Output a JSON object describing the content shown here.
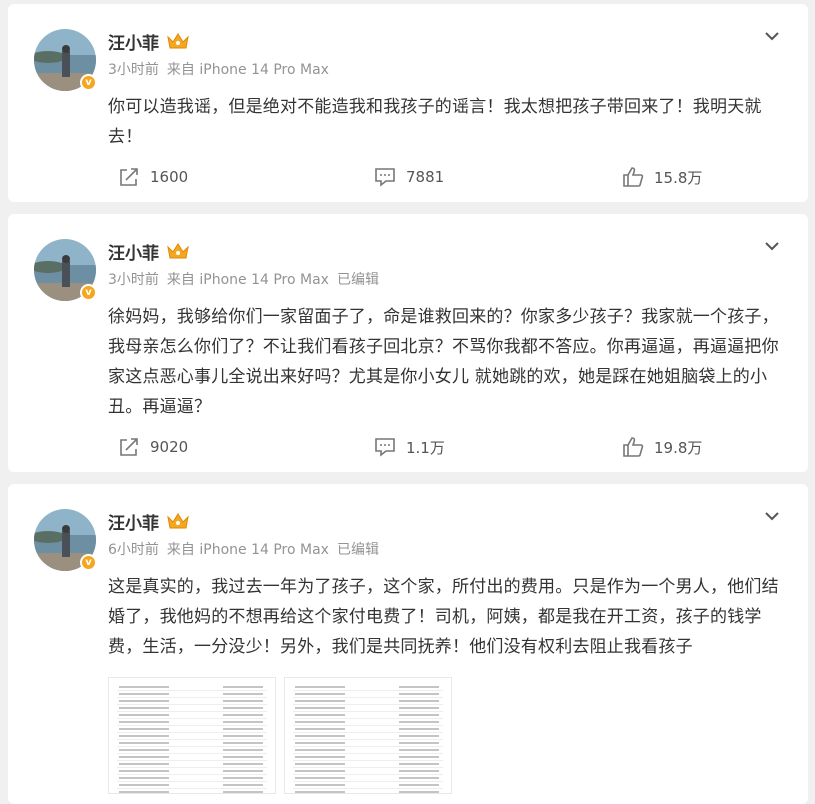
{
  "posts": [
    {
      "author": "汪小菲",
      "time": "3小时前",
      "source": "来自 iPhone 14 Pro Max",
      "edited": "",
      "text": "你可以造我谣，但是绝对不能造我和我孩子的谣言！我太想把孩子带回来了！我明天就去！",
      "reposts": "1600",
      "comments": "7881",
      "likes": "15.8万"
    },
    {
      "author": "汪小菲",
      "time": "3小时前",
      "source": "来自 iPhone 14 Pro Max",
      "edited": "已编辑",
      "text": "徐妈妈，我够给你们一家留面子了，命是谁救回来的？你家多少孩子？我家就一个孩子，我母亲怎么你们了？不让我们看孩子回北京？不骂你我都不答应。你再逼逼，再逼逼把你家这点恶心事儿全说出来好吗？尤其是你小女儿 就她跳的欢，她是踩在她姐脑袋上的小丑。再逼逼？",
      "reposts": "9020",
      "comments": "1.1万",
      "likes": "19.8万"
    },
    {
      "author": "汪小菲",
      "time": "6小时前",
      "source": "来自 iPhone 14 Pro Max",
      "edited": "已编辑",
      "text": "这是真实的，我过去一年为了孩子，这个家，所付出的费用。只是作为一个男人，他们结婚了，我他妈的不想再给这个家付电费了！司机，阿姨，都是我在开工资，孩子的钱学费，生活，一分没少！另外，我们是共同抚养！他们没有权利去阻止我看孩子"
    }
  ],
  "colors": {
    "badge": "#f7a51c",
    "crown": "#f5a623",
    "text": "#333333",
    "meta": "#939393"
  },
  "icons": [
    "verified-badge-icon",
    "crown-icon",
    "chevron-down-icon",
    "repost-icon",
    "comment-icon",
    "like-icon"
  ]
}
